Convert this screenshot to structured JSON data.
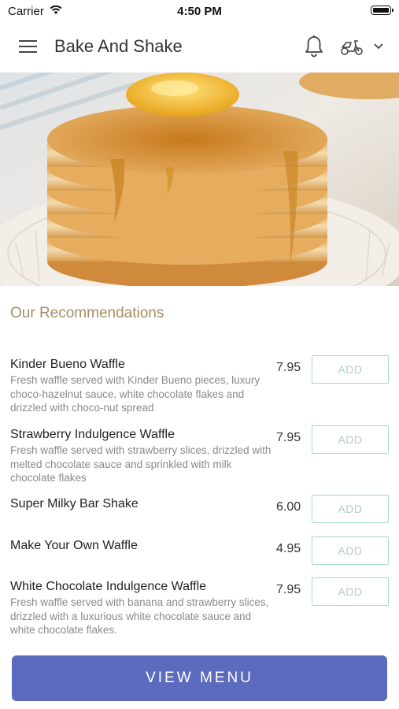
{
  "status_bar": {
    "carrier": "Carrier",
    "time": "4:50 PM"
  },
  "header": {
    "title": "Bake And Shake",
    "icons": [
      "menu-icon",
      "bell-icon",
      "scooter-icon",
      "chevron-down-icon"
    ]
  },
  "hero": {
    "image": "pancake-stack-photo"
  },
  "recommendations": {
    "title": "Our Recommendations",
    "items": [
      {
        "name": "Kinder Bueno Waffle",
        "description": "Fresh waffle served with Kinder Bueno pieces, luxury choco-hazelnut sauce, white chocolate flakes and drizzled with choco-nut spread",
        "price": "7.95",
        "add_label": "ADD"
      },
      {
        "name": "Strawberry Indulgence Waffle",
        "description": "Fresh waffle served with strawberry slices, drizzled with melted chocolate sauce and sprinkled with milk chocolate flakes",
        "price": "7.95",
        "add_label": "ADD"
      },
      {
        "name": "Super Milky Bar Shake",
        "description": "",
        "price": "6.00",
        "add_label": "ADD"
      },
      {
        "name": "Make Your Own Waffle",
        "description": "",
        "price": "4.95",
        "add_label": "ADD"
      },
      {
        "name": "White Chocolate Indulgence Waffle",
        "description": "Fresh waffle served with banana and strawberry slices, drizzled with a luxurious white chocolate sauce and white chocolate flakes.",
        "price": "7.95",
        "add_label": "ADD"
      }
    ]
  },
  "footer": {
    "view_menu_label": "VIEW MENU"
  },
  "colors": {
    "accent": "#5c6bbd",
    "section_title": "#a68f65",
    "add_border": "#a7dcc1",
    "add_text": "#b6ccc0",
    "description": "#8a8a8a"
  }
}
